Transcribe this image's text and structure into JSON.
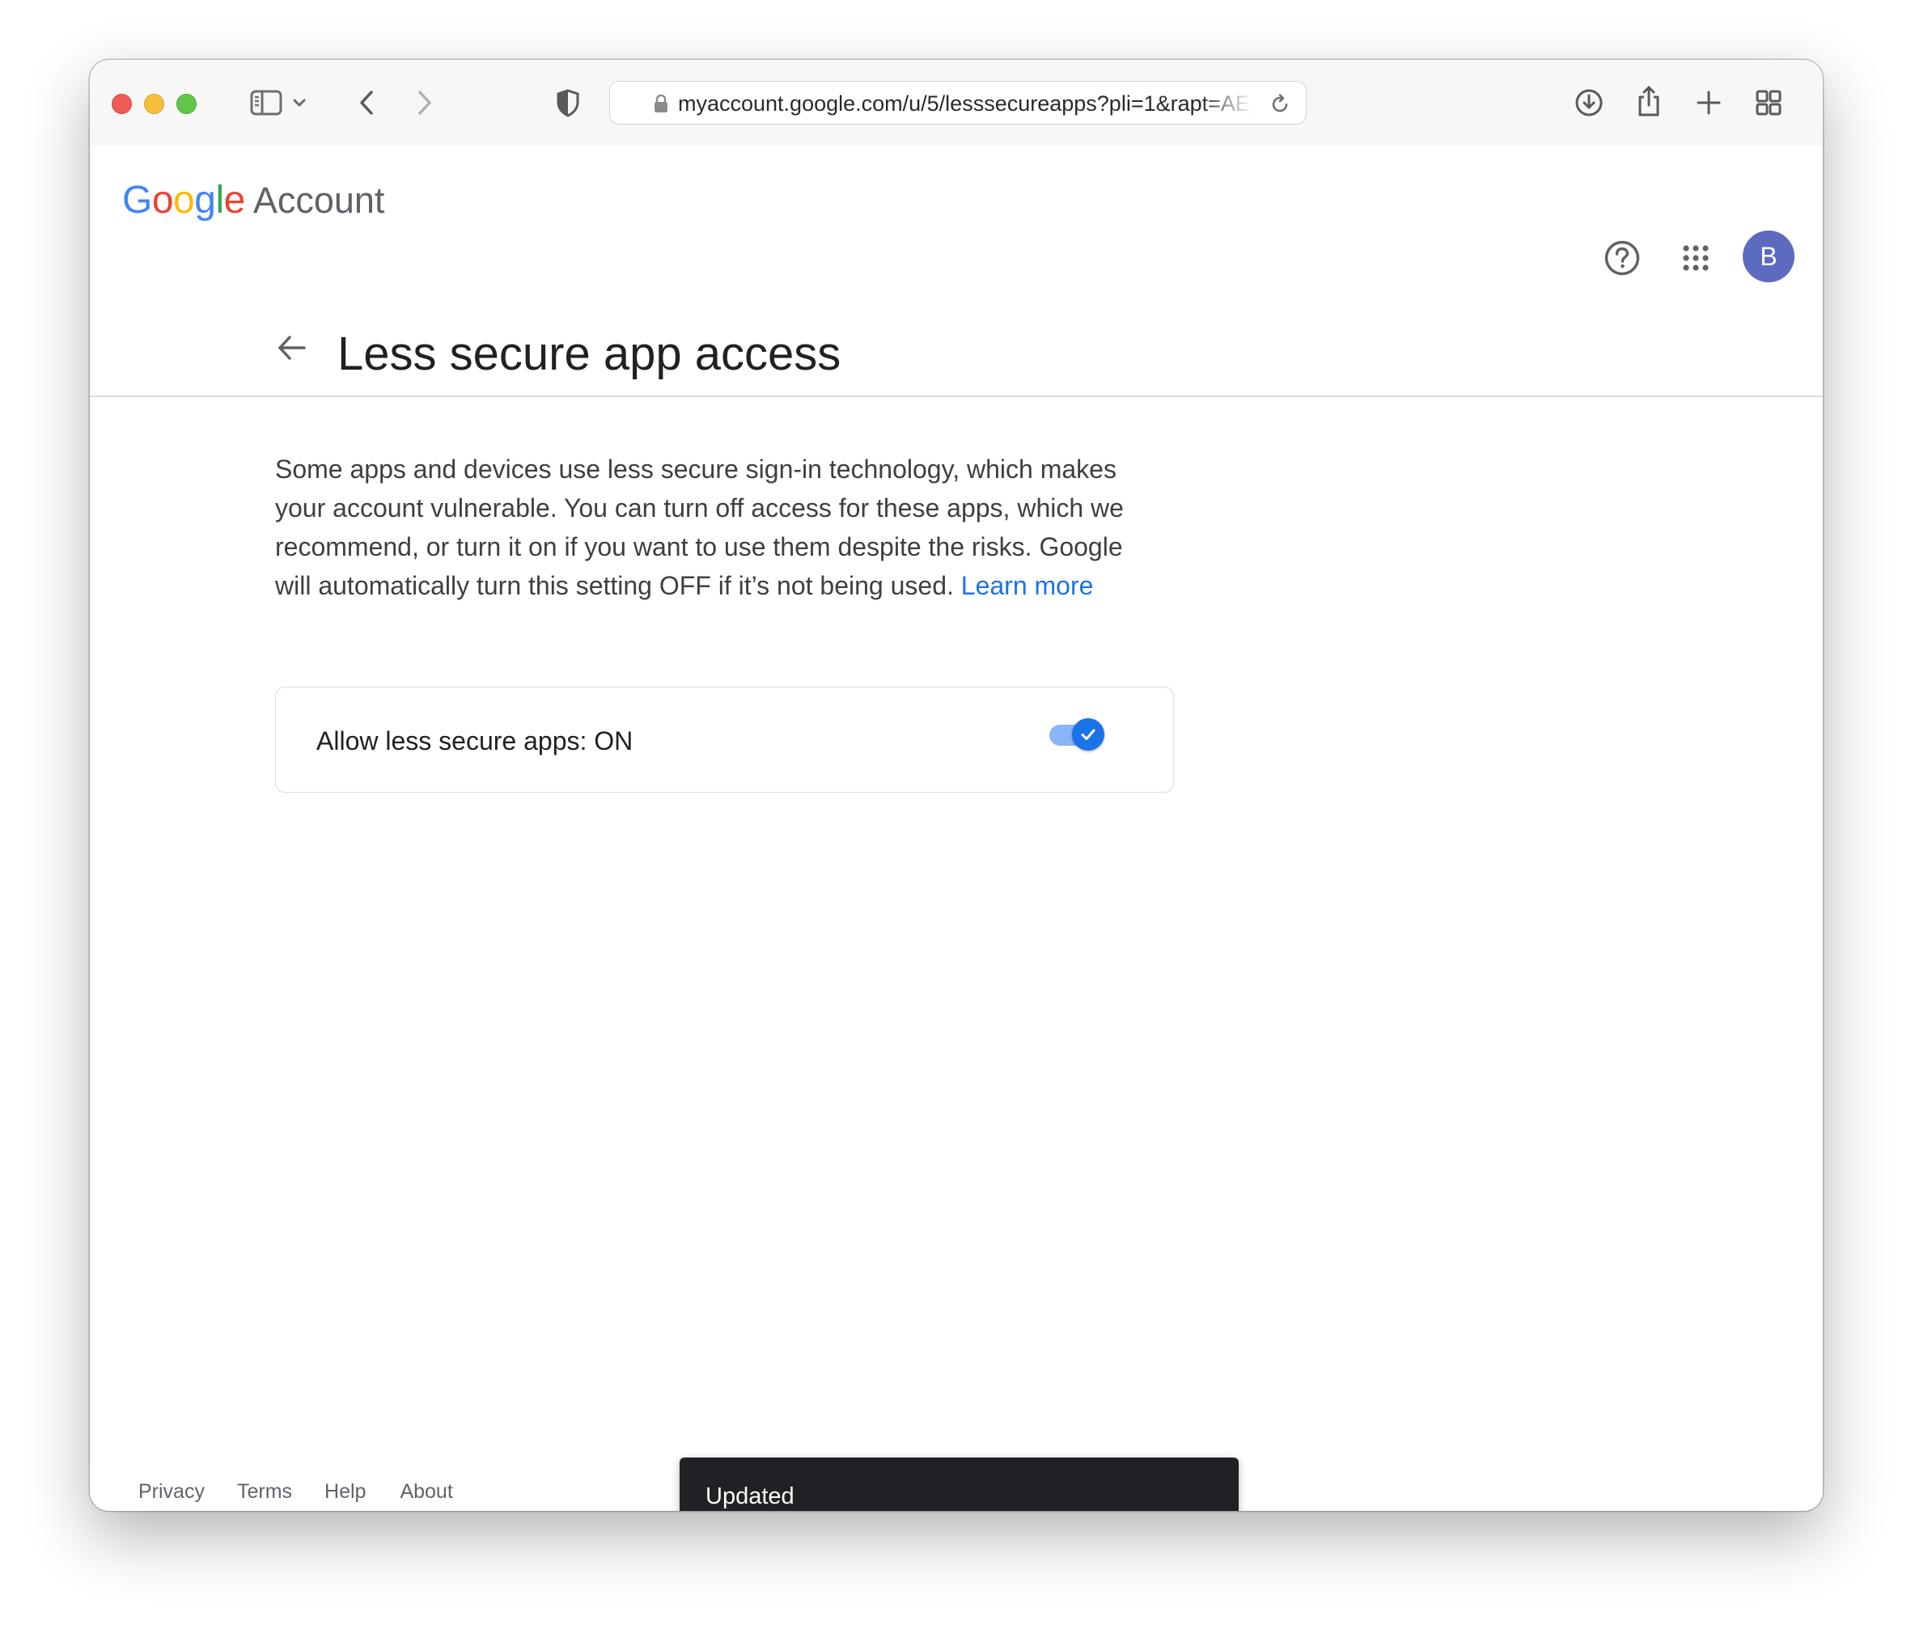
{
  "browser": {
    "url": "myaccount.google.com/u/5/lesssecureapps?pli=1&rapt=AEjHL4NNfyGLaZBJqfDSwwJqOXhXiMrZ",
    "icons": [
      "sidebar-icon",
      "chevron-down-icon",
      "back-icon",
      "forward-icon",
      "shield-icon",
      "lock-icon",
      "reload-icon",
      "download-icon",
      "share-icon",
      "plus-icon",
      "tab-overview-icon"
    ]
  },
  "header": {
    "logo_letters": [
      "G",
      "o",
      "o",
      "g",
      "l",
      "e"
    ],
    "logo_colors": [
      "#4285f4",
      "#ea4335",
      "#fbbc05",
      "#4285f4",
      "#34a853",
      "#ea4335"
    ],
    "logo_suffix": "Account",
    "help_icon": "help-icon",
    "apps_icon": "apps-grid-icon",
    "avatar_initial": "B",
    "avatar_color": "#5c6bc0"
  },
  "page": {
    "title": "Less secure app access",
    "description": "Some apps and devices use less secure sign-in technology, which makes your account vulnerable. You can turn off access for these apps, which we recommend, or turn it on if you want to use them despite the risks. Google will automatically turn this setting OFF if it’s not being used.",
    "learn_more": "Learn more"
  },
  "setting": {
    "label": "Allow less secure apps: ON",
    "enabled": true,
    "accent": "#1a73e8"
  },
  "footer": {
    "links": [
      "Privacy",
      "Terms",
      "Help",
      "About"
    ]
  },
  "snackbar": {
    "message": "Updated"
  }
}
